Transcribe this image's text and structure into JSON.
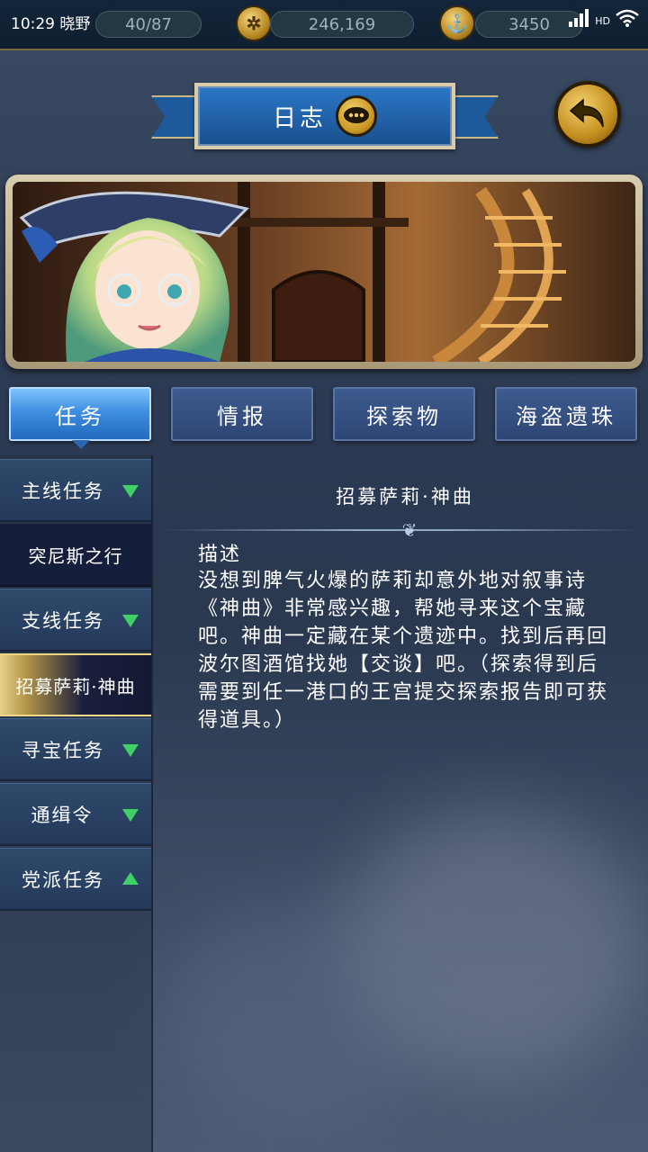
{
  "status": {
    "time": "10:29",
    "carrier": "晓野",
    "network": "HD"
  },
  "resources": {
    "level_text": "40/87",
    "gold": "246,169",
    "diamond": "3450"
  },
  "header": {
    "title": "日志"
  },
  "tabs": [
    {
      "label": "任务",
      "active": true
    },
    {
      "label": "情报",
      "active": false
    },
    {
      "label": "探索物",
      "active": false
    },
    {
      "label": "海盗遗珠",
      "active": false
    }
  ],
  "sidebar": {
    "items": [
      {
        "kind": "category",
        "label": "主线任务",
        "state": "collapsed"
      },
      {
        "kind": "subitem",
        "label": "突尼斯之行",
        "selected": false
      },
      {
        "kind": "category",
        "label": "支线任务",
        "state": "collapsed"
      },
      {
        "kind": "subitem",
        "label": "招募萨莉·神曲",
        "selected": true
      },
      {
        "kind": "category",
        "label": "寻宝任务",
        "state": "collapsed"
      },
      {
        "kind": "category",
        "label": "通缉令",
        "state": "collapsed"
      },
      {
        "kind": "category",
        "label": "党派任务",
        "state": "expanded"
      }
    ]
  },
  "detail": {
    "title": "招募萨莉·神曲",
    "desc_label": "描述",
    "description": "没想到脾气火爆的萨莉却意外地对叙事诗《神曲》非常感兴趣，帮她寻来这个宝藏吧。神曲一定藏在某个遗迹中。找到后再回波尔图酒馆找她【交谈】吧。（探索得到后需要到任一港口的王宫提交探索报告即可获得道具。）"
  },
  "colors": {
    "accent_green": "#3fd166",
    "tab_active": "#3e8ee0",
    "gold": "#c99521"
  }
}
